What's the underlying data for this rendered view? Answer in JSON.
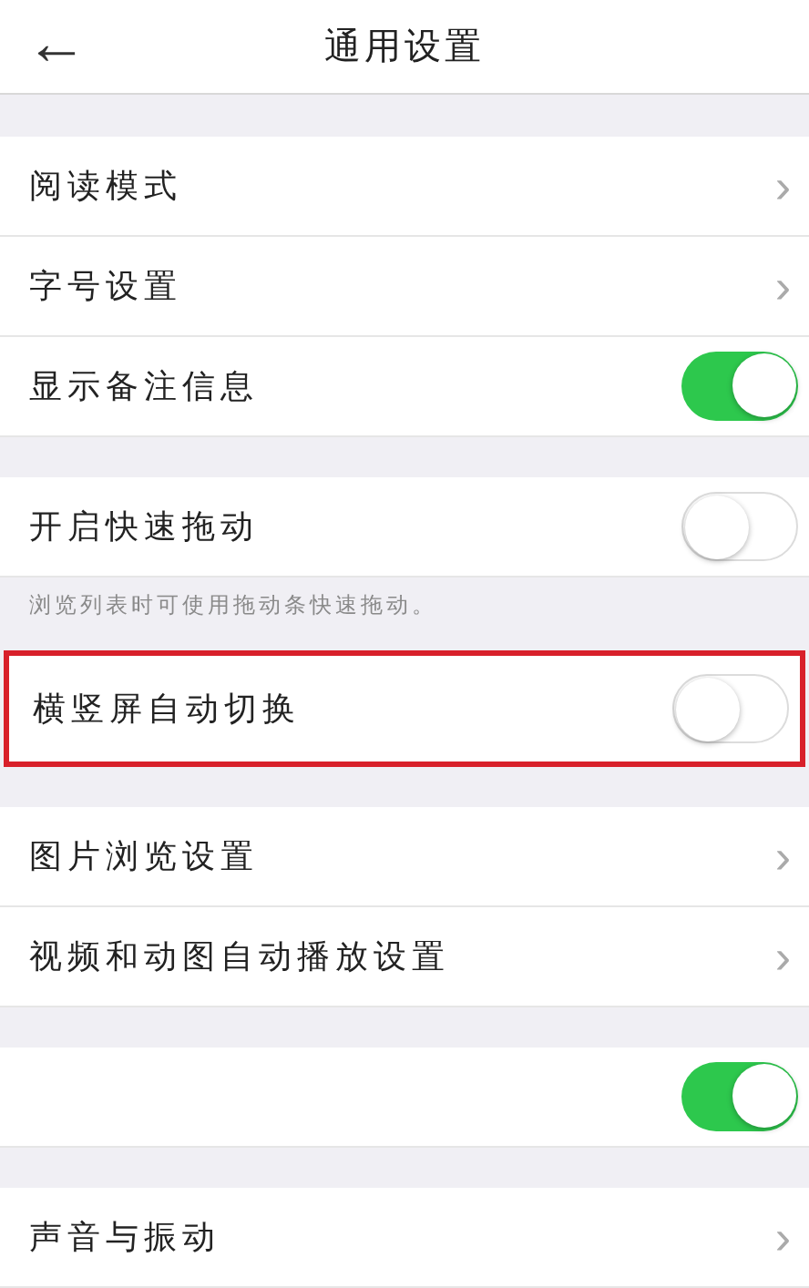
{
  "header": {
    "back": "←",
    "title": "通用设置"
  },
  "sections": [
    {
      "rows": [
        {
          "kind": "link",
          "label": "阅读模式",
          "chevron": "›",
          "highlighted": false
        },
        {
          "kind": "link",
          "label": "字号设置",
          "chevron": "›",
          "highlighted": false
        },
        {
          "kind": "toggle",
          "label": "显示备注信息",
          "on": true,
          "highlighted": false
        }
      ]
    },
    {
      "rows": [
        {
          "kind": "toggle",
          "label": "开启快速拖动",
          "on": false,
          "highlighted": false
        }
      ],
      "hint": "浏览列表时可使用拖动条快速拖动。"
    },
    {
      "rows": [
        {
          "kind": "toggle",
          "label": "横竖屏自动切换",
          "on": false,
          "highlighted": true
        }
      ]
    },
    {
      "rows": [
        {
          "kind": "link",
          "label": "图片浏览设置",
          "chevron": "›",
          "highlighted": false
        },
        {
          "kind": "link",
          "label": "视频和动图自动播放设置",
          "chevron": "›",
          "highlighted": false
        }
      ]
    },
    {
      "rows": [
        {
          "kind": "toggle",
          "on": true,
          "highlighted": false
        }
      ]
    },
    {
      "rows": [
        {
          "kind": "link",
          "label": "声音与振动",
          "chevron": "›",
          "highlighted": false
        }
      ]
    }
  ]
}
